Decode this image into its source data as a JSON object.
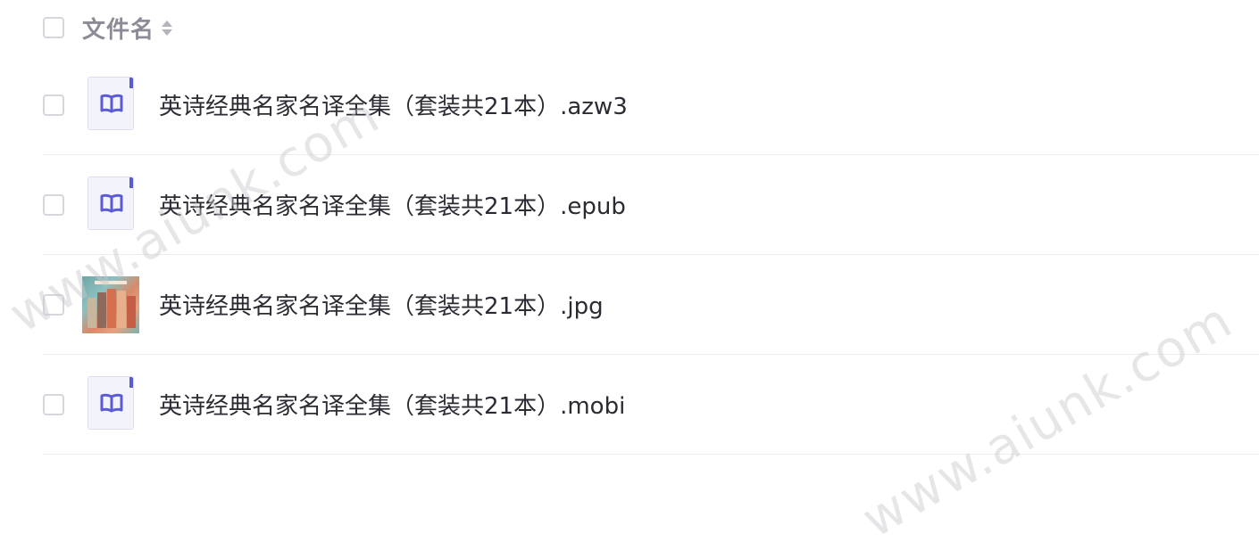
{
  "header": {
    "column_label": "文件名"
  },
  "files": [
    {
      "name": "英诗经典名家名译全集（套装共21本）.azw3",
      "icon": "ebook-icon"
    },
    {
      "name": "英诗经典名家名译全集（套装共21本）.epub",
      "icon": "ebook-icon"
    },
    {
      "name": "英诗经典名家名译全集（套装共21本）.jpg",
      "icon": "image-thumbnail"
    },
    {
      "name": "英诗经典名家名译全集（套装共21本）.mobi",
      "icon": "ebook-icon"
    }
  ],
  "watermark": {
    "text": "www.aiunk.com"
  },
  "colors": {
    "icon_accent": "#5b5bd6",
    "text": "#2b2b33",
    "header_text": "#8c8c96",
    "divider": "#ededf0"
  }
}
